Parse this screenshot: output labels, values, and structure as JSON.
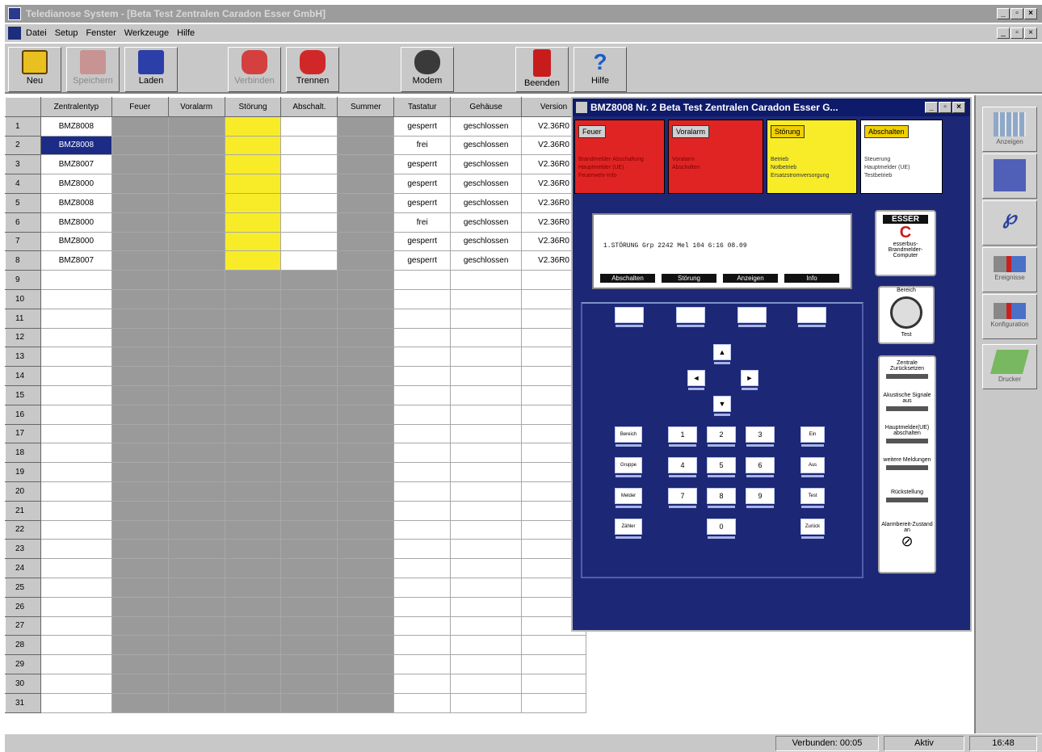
{
  "window": {
    "title": "Teledianose System - [Beta Test Zentralen Caradon Esser GmbH]",
    "controls": [
      "_",
      "▫",
      "×"
    ]
  },
  "menu": [
    "Datei",
    "Setup",
    "Fenster",
    "Werkzeuge",
    "Hilfe"
  ],
  "toolbar": [
    {
      "label": "Neu",
      "icon": "book-icon",
      "enabled": true
    },
    {
      "label": "Speichern",
      "icon": "save-arrow-icon",
      "enabled": false
    },
    {
      "label": "Laden",
      "icon": "load-icon",
      "enabled": true
    },
    {
      "label": "Verbinden",
      "icon": "phone-connect-icon",
      "enabled": false
    },
    {
      "label": "Trennen",
      "icon": "phone-hangup-icon",
      "enabled": true
    },
    {
      "label": "Modem",
      "icon": "modem-icon",
      "enabled": true
    },
    {
      "label": "Beenden",
      "icon": "exit-door-icon",
      "enabled": true
    },
    {
      "label": "Hilfe",
      "icon": "help-question-icon",
      "enabled": true
    }
  ],
  "grid": {
    "columns": [
      "Zentralentyp",
      "Feuer",
      "Voralarm",
      "Störung",
      "Abschalt.",
      "Summer",
      "Tastatur",
      "Gehäuse",
      "Version"
    ],
    "rows": [
      {
        "n": "1",
        "typ": "BMZ8008",
        "stoerung": true,
        "abschalt": true,
        "tastatur": "gesperrt",
        "gehaeuse": "geschlossen",
        "version": "V2.36R0"
      },
      {
        "n": "2",
        "typ": "BMZ8008",
        "stoerung": true,
        "abschalt": true,
        "tastatur": "frei",
        "gehaeuse": "geschlossen",
        "version": "V2.36R0",
        "selected": true
      },
      {
        "n": "3",
        "typ": "BMZ8007",
        "stoerung": true,
        "abschalt": true,
        "tastatur": "gesperrt",
        "gehaeuse": "geschlossen",
        "version": "V2.36R0"
      },
      {
        "n": "4",
        "typ": "BMZ8000",
        "stoerung": true,
        "abschalt": true,
        "tastatur": "gesperrt",
        "gehaeuse": "geschlossen",
        "version": "V2.36R0"
      },
      {
        "n": "5",
        "typ": "BMZ8008",
        "stoerung": true,
        "abschalt": true,
        "tastatur": "gesperrt",
        "gehaeuse": "geschlossen",
        "version": "V2.36R0"
      },
      {
        "n": "6",
        "typ": "BMZ8000",
        "stoerung": true,
        "abschalt": true,
        "tastatur": "frei",
        "gehaeuse": "geschlossen",
        "version": "V2.36R0"
      },
      {
        "n": "7",
        "typ": "BMZ8000",
        "stoerung": true,
        "abschalt": true,
        "tastatur": "gesperrt",
        "gehaeuse": "geschlossen",
        "version": "V2.36R0"
      },
      {
        "n": "8",
        "typ": "BMZ8007",
        "stoerung": true,
        "abschalt": true,
        "tastatur": "gesperrt",
        "gehaeuse": "geschlossen",
        "version": "V2.36R0"
      },
      {
        "n": "9"
      },
      {
        "n": "10"
      },
      {
        "n": "11"
      },
      {
        "n": "12"
      },
      {
        "n": "13"
      },
      {
        "n": "14"
      },
      {
        "n": "15"
      },
      {
        "n": "16"
      },
      {
        "n": "17"
      },
      {
        "n": "18"
      },
      {
        "n": "19"
      },
      {
        "n": "20"
      },
      {
        "n": "21"
      },
      {
        "n": "22"
      },
      {
        "n": "23"
      },
      {
        "n": "24"
      },
      {
        "n": "25"
      },
      {
        "n": "26"
      },
      {
        "n": "27"
      },
      {
        "n": "28"
      },
      {
        "n": "29"
      },
      {
        "n": "30"
      },
      {
        "n": "31"
      }
    ]
  },
  "panel": {
    "title": "BMZ8008 Nr. 2  Beta Test Zentralen Caradon Esser G...",
    "status_boxes": [
      {
        "header": "Feuer",
        "color": "#e02424",
        "items": [
          "Brandmelder-Abschaltung",
          "Hauptmelder (UE)",
          "Feuerwehr-Info"
        ]
      },
      {
        "header": "Voralarm",
        "color": "#e02424",
        "items": [
          "Voralarm",
          "Abschalten",
          ""
        ]
      },
      {
        "header": "Störung",
        "color": "#f8ec28",
        "items": [
          "Betrieb",
          "Notbetrieb",
          "Ersatzstromversorgung"
        ]
      },
      {
        "header": "Abschalten",
        "color": "#ffffff",
        "items": [
          "Steuerung",
          "Hauptmelder (UE)",
          "Testbetrieb"
        ]
      }
    ],
    "lcd": {
      "line": "1.STÖRUNG  Grp 2242 Mel 104    6:16 08.09",
      "softkeys": [
        "Abschalten",
        "Störung",
        "Anzeigen",
        "Info"
      ]
    },
    "keys": {
      "left": [
        "Bereich",
        "Gruppe",
        "Melder",
        "Zähler"
      ],
      "numbers": [
        "1",
        "2",
        "3",
        "4",
        "5",
        "6",
        "7",
        "8",
        "9",
        "0"
      ],
      "right": [
        "Ein",
        "Aus",
        "Test",
        "Zurück"
      ],
      "arrows": [
        "▲",
        "◄",
        "►",
        "▼"
      ]
    },
    "brand": {
      "logo": "ESSER",
      "text": "esserbus-Brandmelder-Computer"
    },
    "switch": {
      "top": "Bereich",
      "bottom": "Test"
    },
    "right_buttons": [
      "Zentrale Zurücksetzen",
      "Akustische Signale aus",
      "Hauptmelder(UE) abschalten",
      "weitere Meldungen",
      "Rückstellung",
      "Alarmbereit-Zustand an"
    ]
  },
  "dock": [
    {
      "label": "Anzeigen",
      "icon": "grid-table-icon"
    },
    {
      "label": "",
      "icon": "panel-icon"
    },
    {
      "label": "",
      "icon": "tool-logo-icon"
    },
    {
      "label": "Ereignisse",
      "icon": "transfer-icon"
    },
    {
      "label": "Konfiguration",
      "icon": "transfer2-icon"
    },
    {
      "label": "Drucker",
      "icon": "printer-icon"
    }
  ],
  "statusbar": {
    "connected": "Verbunden: 00:05",
    "state": "Aktiv",
    "time": "16:48"
  }
}
